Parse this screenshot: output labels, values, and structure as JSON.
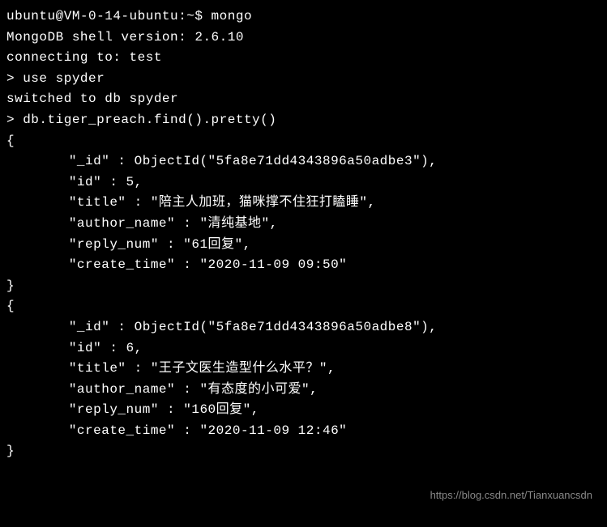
{
  "prompt_line": "ubuntu@VM-0-14-ubuntu:~$ mongo",
  "shell_version": "MongoDB shell version: 2.6.10",
  "connecting": "connecting to: test",
  "use_cmd": "> use spyder",
  "switched": "switched to db spyder",
  "find_cmd": "> db.tiger_preach.find().pretty()",
  "brace_open": "{",
  "brace_close": "}",
  "records": [
    {
      "id_line": "\"_id\" : ObjectId(\"5fa8e71dd4343896a50adbe3\"),",
      "num_line": "\"id\" : 5,",
      "title_line": "\"title\" : \"陪主人加班，猫咪撑不住狂打瞌睡\",",
      "author_line": "\"author_name\" : \"清纯基地\",",
      "reply_line": "\"reply_num\" : \"61回复\",",
      "time_line": "\"create_time\" : \"2020-11-09 09:50\""
    },
    {
      "id_line": "\"_id\" : ObjectId(\"5fa8e71dd4343896a50adbe8\"),",
      "num_line": "\"id\" : 6,",
      "title_line": "\"title\" : \"王子文医生造型什么水平？\",",
      "author_line": "\"author_name\" : \"有态度的小可爱\",",
      "reply_line": "\"reply_num\" : \"160回复\",",
      "time_line": "\"create_time\" : \"2020-11-09 12:46\""
    }
  ],
  "watermark": "https://blog.csdn.net/Tianxuancsdn"
}
